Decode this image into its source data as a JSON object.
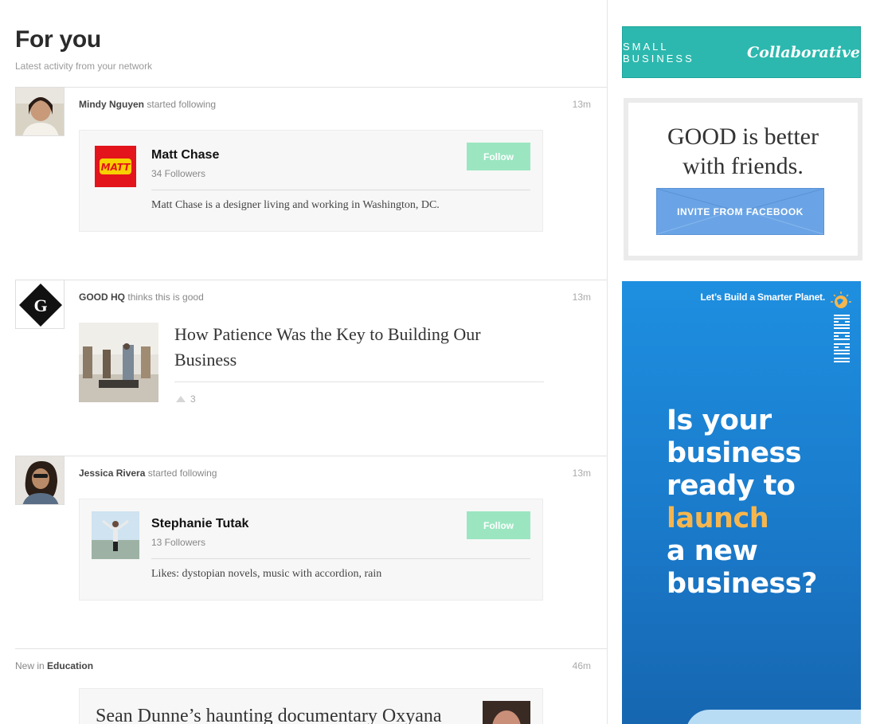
{
  "header": {
    "title": "For you",
    "subtitle": "Latest activity from your network"
  },
  "feed": [
    {
      "actor": "Mindy Nguyen",
      "action": "started following",
      "time": "13m",
      "card": {
        "name": "Matt Chase",
        "followers": "34 Followers",
        "follow_label": "Follow",
        "bio": "Matt Chase is a designer living and working in Washington, DC.",
        "logo_text": "MATT"
      }
    },
    {
      "actor": "GOOD HQ",
      "action": "thinks this is good",
      "time": "13m",
      "avatar_letter": "G",
      "article": {
        "title": "How Patience Was the Key to Building Our Business",
        "votes": "3"
      }
    },
    {
      "actor": "Jessica Rivera",
      "action": "started following",
      "time": "13m",
      "card": {
        "name": "Stephanie Tutak",
        "followers": "13 Followers",
        "follow_label": "Follow",
        "bio": "Likes: dystopian novels, music with accordion, rain"
      }
    },
    {
      "prefix": "New in",
      "category": "Education",
      "time": "46m",
      "article": {
        "title": "Sean Dunne’s haunting documentary Oxyana"
      }
    }
  ],
  "sidebar": {
    "sbc_ad": {
      "plain": "SMALL BUSINESS",
      "script": "Collaborative"
    },
    "invite_ad": {
      "headline_line1": "GOOD is better",
      "headline_line2": "with friends.",
      "button": "INVITE FROM FACEBOOK"
    },
    "ibm_ad": {
      "tagline": "Let’s Build a Smarter Planet.",
      "line1": "Is your",
      "line2": "business",
      "line3": "ready to",
      "accent": "launch",
      "line4": "a new",
      "line5": "business?"
    }
  },
  "colors": {
    "follow_button": "#9be6c1",
    "sbc_teal": "#2cb8ae",
    "facebook_blue": "#6aa4e6",
    "ibm_blue": "#1e8fe0",
    "ibm_accent": "#f6b64d"
  }
}
